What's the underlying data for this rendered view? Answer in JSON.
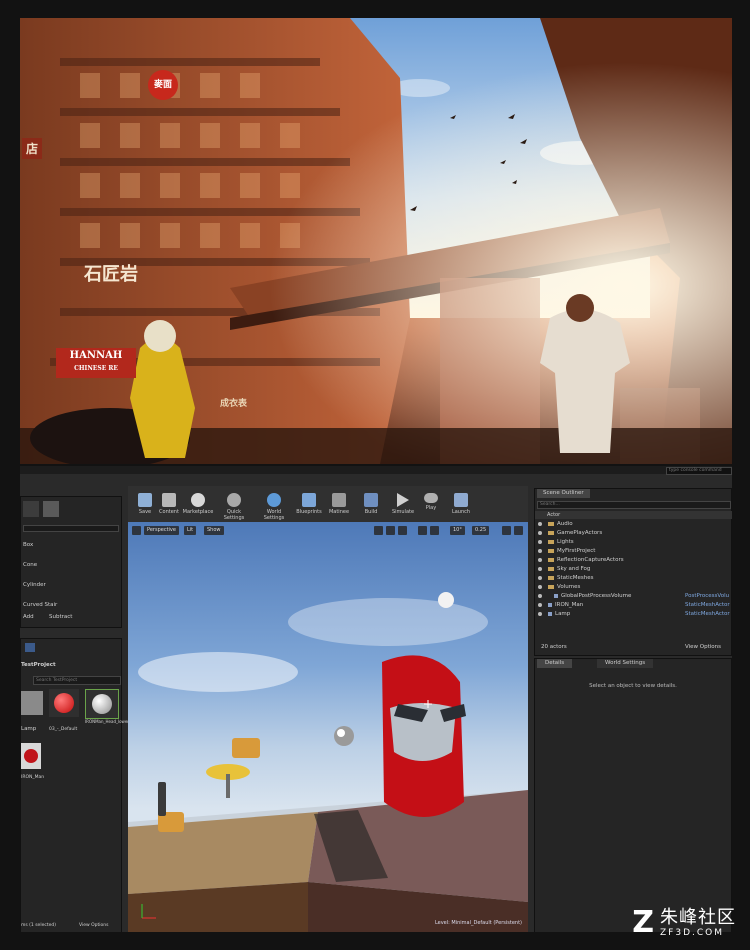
{
  "render": {
    "signs": [
      "麥面",
      "石匠岩",
      "HANNAH",
      "CHINESE RE",
      "成衣表",
      "店"
    ]
  },
  "toolbar": {
    "buttons": [
      {
        "label": "Save",
        "icon": "save-icon"
      },
      {
        "label": "Content",
        "icon": "content-icon"
      },
      {
        "label": "Marketplace",
        "icon": "marketplace-icon"
      },
      {
        "label": "Quick Settings",
        "icon": "gear-icon"
      },
      {
        "label": "World Settings",
        "icon": "globe-icon"
      },
      {
        "label": "Blueprints",
        "icon": "blueprint-icon"
      },
      {
        "label": "Matinee",
        "icon": "clapper-icon"
      },
      {
        "label": "Build",
        "icon": "build-icon"
      },
      {
        "label": "Simulate",
        "icon": "play-icon"
      },
      {
        "label": "Play",
        "icon": "gamepad-icon"
      },
      {
        "label": "Launch",
        "icon": "launch-icon"
      }
    ]
  },
  "place_panel": {
    "items": [
      "Box",
      "Cone",
      "Cylinder",
      "Curved Stair"
    ],
    "add_label": "Add",
    "subtract_label": "Subtract"
  },
  "content_browser": {
    "project": "TestProject",
    "search_placeholder": "Search TestProject",
    "assets": [
      "Lamp",
      "03_-_Default",
      "IRONMan_Head_lowerbite",
      "IRON_Man"
    ],
    "status": "ms (1 selected)",
    "view_options": "View Options"
  },
  "viewport": {
    "mode_label": "Perspective",
    "lit_label": "Lit",
    "show_label": "Show",
    "angle": "10°",
    "scale": "0.25",
    "level_label": "Level: Minimal_Default (Persistent)"
  },
  "outliner": {
    "title": "Scene Outliner",
    "search_placeholder": "Search...",
    "column": "Actor",
    "rows": [
      {
        "label": "Audio",
        "type": "",
        "depth": 0
      },
      {
        "label": "GamePlayActors",
        "type": "",
        "depth": 0
      },
      {
        "label": "Lights",
        "type": "",
        "depth": 0
      },
      {
        "label": "MyFirstProject",
        "type": "",
        "depth": 0
      },
      {
        "label": "ReflectionCaptureActors",
        "type": "",
        "depth": 0
      },
      {
        "label": "Sky and Fog",
        "type": "",
        "depth": 0
      },
      {
        "label": "StaticMeshes",
        "type": "",
        "depth": 0
      },
      {
        "label": "Volumes",
        "type": "",
        "depth": 0
      },
      {
        "label": "GlobalPostProcessVolume",
        "type": "PostProcessVolu",
        "depth": 1
      },
      {
        "label": "IRON_Man",
        "type": "StaticMeshActor",
        "depth": 0
      },
      {
        "label": "Lamp",
        "type": "StaticMeshActor",
        "depth": 0
      }
    ],
    "actor_count": "20 actors",
    "view_options": "View Options"
  },
  "details": {
    "tab1": "Details",
    "tab2": "World Settings",
    "empty_text": "Select an object to view details."
  },
  "top_right_field": "type console command",
  "watermark": {
    "brand": "朱峰社区",
    "url": "ZF3D.COM"
  }
}
